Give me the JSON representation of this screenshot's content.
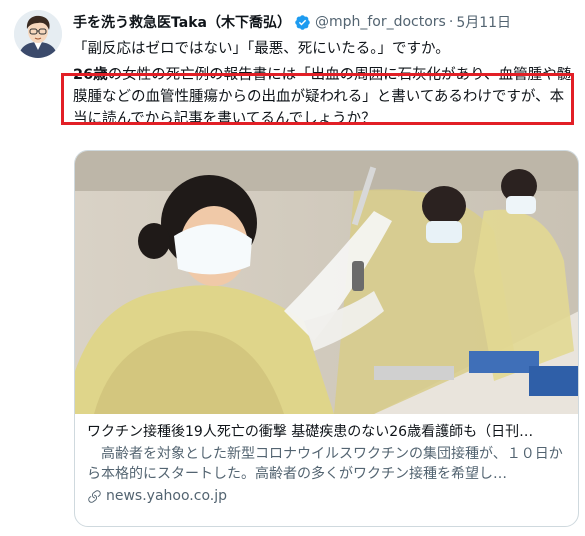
{
  "tweet": {
    "display_name": "手を洗う救急医Taka（木下喬弘）",
    "verified": true,
    "handle": "@mph_for_doctors",
    "separator": "·",
    "date": "5月11日",
    "line1": "「副反応はゼロではない」「最悪、死にいたる。」ですか。",
    "para_strong": "26歳",
    "para_rest": "の女性の死亡例の報告書には「出血の周囲に石灰化があり、血管腫や髄膜腫などの血管性腫瘍からの出血が疑われる」と書いてあるわけですが、本当に読んでから記事を書いてるんでしょうか？"
  },
  "card": {
    "image_alt": "看護師たちがワクチンを準備している写真",
    "title": "ワクチン接種後19人死亡の衝撃 基礎疾患のない26歳看護師も（日刊…",
    "description": "　高齢者を対象とした新型コロナウイルスワクチンの集団接種が、１０日から本格的にスタートした。高齢者の多くがワクチン接種を希望し…",
    "domain": "news.yahoo.co.jp"
  },
  "colors": {
    "highlight_border": "#e21f26",
    "verified_blue": "#1d9bf0",
    "secondary_text": "#536471",
    "card_border": "#cfd9de"
  },
  "icons": {
    "verified": "verified-badge-icon",
    "link": "link-icon"
  }
}
